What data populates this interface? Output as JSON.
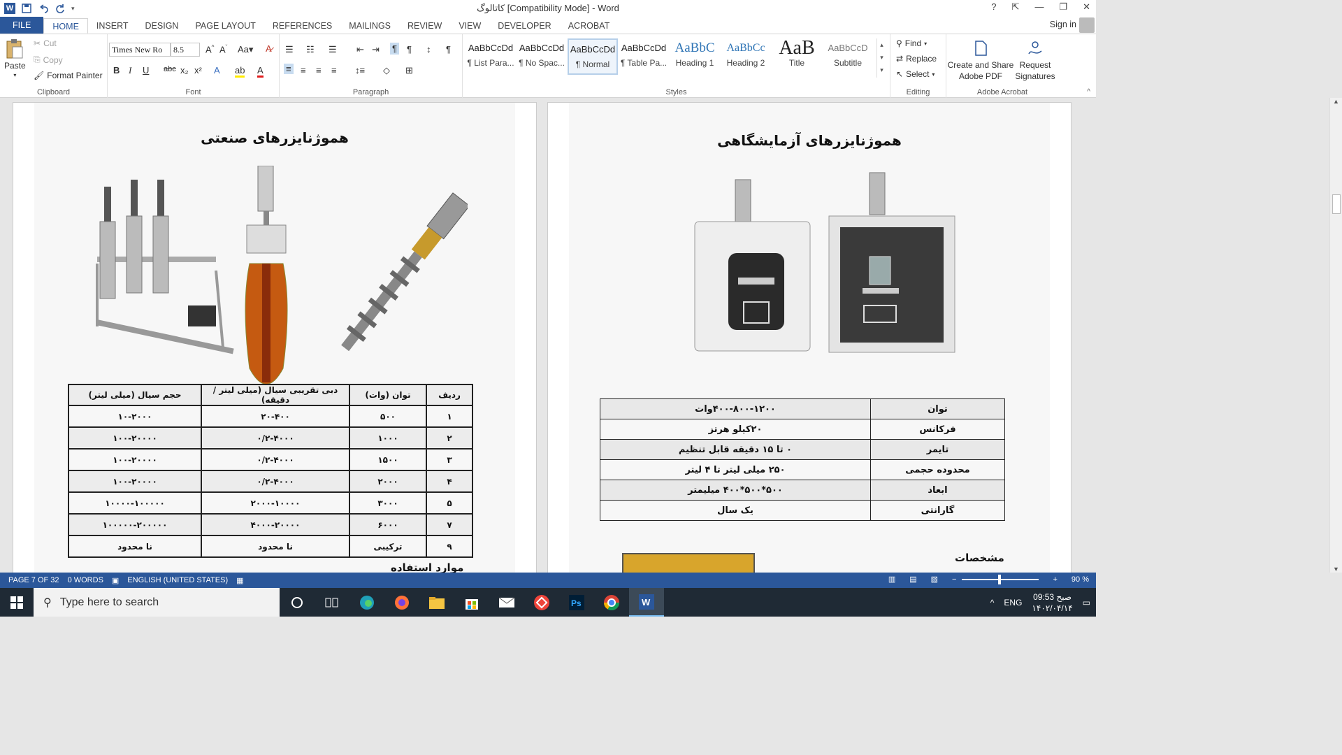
{
  "window": {
    "title": "کاتالوگ [Compatibility Mode] - Word",
    "help": "?",
    "minimize": "—",
    "restore": "❐",
    "close": "✕"
  },
  "tabs": [
    "FILE",
    "HOME",
    "INSERT",
    "DESIGN",
    "PAGE LAYOUT",
    "REFERENCES",
    "MAILINGS",
    "REVIEW",
    "VIEW",
    "DEVELOPER",
    "ACROBAT"
  ],
  "signin": "Sign in",
  "clipboard": {
    "paste": "Paste",
    "cut": "Cut",
    "copy": "Copy",
    "format_painter": "Format Painter",
    "label": "Clipboard"
  },
  "font": {
    "name": "Times New Ro",
    "size": "8.5",
    "label": "Font"
  },
  "paragraph": {
    "label": "Paragraph"
  },
  "styles": {
    "label": "Styles",
    "items": [
      {
        "preview": "AaBbCcDd",
        "name": "¶ List Para..."
      },
      {
        "preview": "AaBbCcDd",
        "name": "¶ No Spac..."
      },
      {
        "preview": "AaBbCcDd",
        "name": "¶ Normal"
      },
      {
        "preview": "AaBbCcDd",
        "name": "¶ Table Pa..."
      },
      {
        "preview": "AaBbC",
        "name": "Heading 1"
      },
      {
        "preview": "AaBbCc",
        "name": "Heading 2"
      },
      {
        "preview": "AaB",
        "name": "Title"
      },
      {
        "preview": "AaBbCcD",
        "name": "Subtitle"
      }
    ]
  },
  "editing": {
    "find": "Find",
    "replace": "Replace",
    "select": "Select",
    "label": "Editing"
  },
  "acrobat": {
    "create_share": "Create and Share Adobe PDF",
    "request_sig": "Request Signatures",
    "label": "Adobe Acrobat"
  },
  "left_page": {
    "title": "هموژنایزرهای صنعتی",
    "headers": [
      "ردیف",
      "توان (وات)",
      "دبی تقریبی سیال  (میلی لیتر / دقیقه)",
      "حجم سیال (میلی لیتر)"
    ],
    "rows": [
      [
        "۱",
        "۵۰۰",
        "۲۰-۴۰۰",
        "۱۰-۲۰۰۰"
      ],
      [
        "۲",
        "۱۰۰۰",
        "۰/۲-۴۰۰۰",
        "۱۰۰-۲۰۰۰۰"
      ],
      [
        "۳",
        "۱۵۰۰",
        "۰/۲-۴۰۰۰",
        "۱۰۰-۲۰۰۰۰"
      ],
      [
        "۴",
        "۲۰۰۰",
        "۰/۲-۴۰۰۰",
        "۱۰۰-۲۰۰۰۰"
      ],
      [
        "۵",
        "۳۰۰۰",
        "۲۰۰۰-۱۰۰۰۰",
        "۱۰۰۰۰-۱۰۰۰۰۰"
      ],
      [
        "۷",
        "۶۰۰۰",
        "۴۰۰۰-۲۰۰۰۰",
        "۱۰۰۰۰۰-۲۰۰۰۰۰"
      ],
      [
        "۹",
        "ترکیبی",
        "نا محدود",
        "نا محدود"
      ]
    ],
    "usage_heading": "موارد استفاده"
  },
  "right_page": {
    "title": "هموژنایزرهای آزمایشگاهی",
    "specs": [
      [
        "توان",
        "۴۰۰-۸۰۰-۱۲۰۰وات"
      ],
      [
        "فرکانس",
        "۲۰کیلو هرتز"
      ],
      [
        "تایمر",
        "۰ تا ۱۵ دقیقه قابل تنظیم"
      ],
      [
        "محدوده حجمی",
        "۲۵۰ میلی لیتر تا ۴ لیتر"
      ],
      [
        "ابعاد",
        "۵۰۰*۵۰۰*۴۰۰ میلیمتر"
      ],
      [
        "گارانتی",
        "یک سال"
      ]
    ],
    "section": "مشخصات"
  },
  "status": {
    "page": "PAGE 7 OF 32",
    "words": "0 WORDS",
    "language": "ENGLISH (UNITED STATES)",
    "zoom": "90 %"
  },
  "taskbar": {
    "search_placeholder": "Type here to search",
    "lang": "ENG",
    "time": "صبح 09:53",
    "date": "۱۴۰۲/۰۴/۱۴"
  },
  "colors": {
    "accent": "#2b579a",
    "taskbar": "#1f2a35"
  }
}
